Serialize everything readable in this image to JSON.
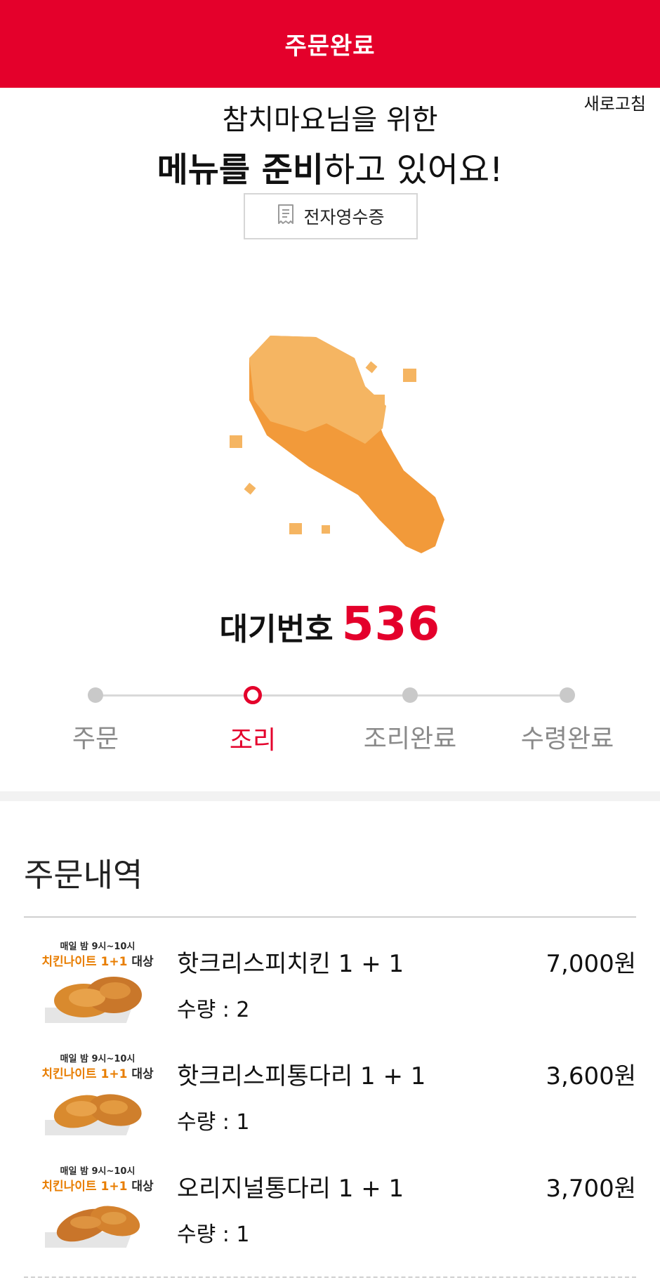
{
  "header": {
    "title": "주문완료"
  },
  "refresh_label": "새로고침",
  "headline": {
    "line1": "참치마요님을 위한",
    "line2_bold": "메뉴를 준비",
    "line2_rest": "하고 있어요!"
  },
  "receipt_button": {
    "label": "전자영수증",
    "icon": "receipt-icon"
  },
  "illustration": {
    "icon": "chicken-drumstick",
    "colors": {
      "light": "#f5b562",
      "dark": "#f29a3a"
    }
  },
  "waiting": {
    "label": "대기번호",
    "number": "536"
  },
  "progress": {
    "steps": [
      {
        "label": "주문",
        "active": false
      },
      {
        "label": "조리",
        "active": true
      },
      {
        "label": "조리완료",
        "active": false
      },
      {
        "label": "수령완료",
        "active": false
      }
    ]
  },
  "order_section": {
    "title": "주문내역",
    "items": [
      {
        "name": "핫크리스피치킨 1 + 1",
        "qty_label": "수량 : 2",
        "price": "7,000원",
        "promo_top": "매일 밤 9시~10시",
        "promo_main": "치킨나이트 1+1",
        "promo_suffix": "대상"
      },
      {
        "name": "핫크리스피통다리 1 + 1",
        "qty_label": "수량 : 1",
        "price": "3,600원",
        "promo_top": "매일 밤 9시~10시",
        "promo_main": "치킨나이트 1+1",
        "promo_suffix": "대상"
      },
      {
        "name": "오리지널통다리 1 + 1",
        "qty_label": "수량 : 1",
        "price": "3,700원",
        "promo_top": "매일 밤 9시~10시",
        "promo_main": "치킨나이트 1+1",
        "promo_suffix": "대상"
      }
    ]
  },
  "colors": {
    "brand": "#e4002b",
    "inactive": "#c9c9c9"
  }
}
